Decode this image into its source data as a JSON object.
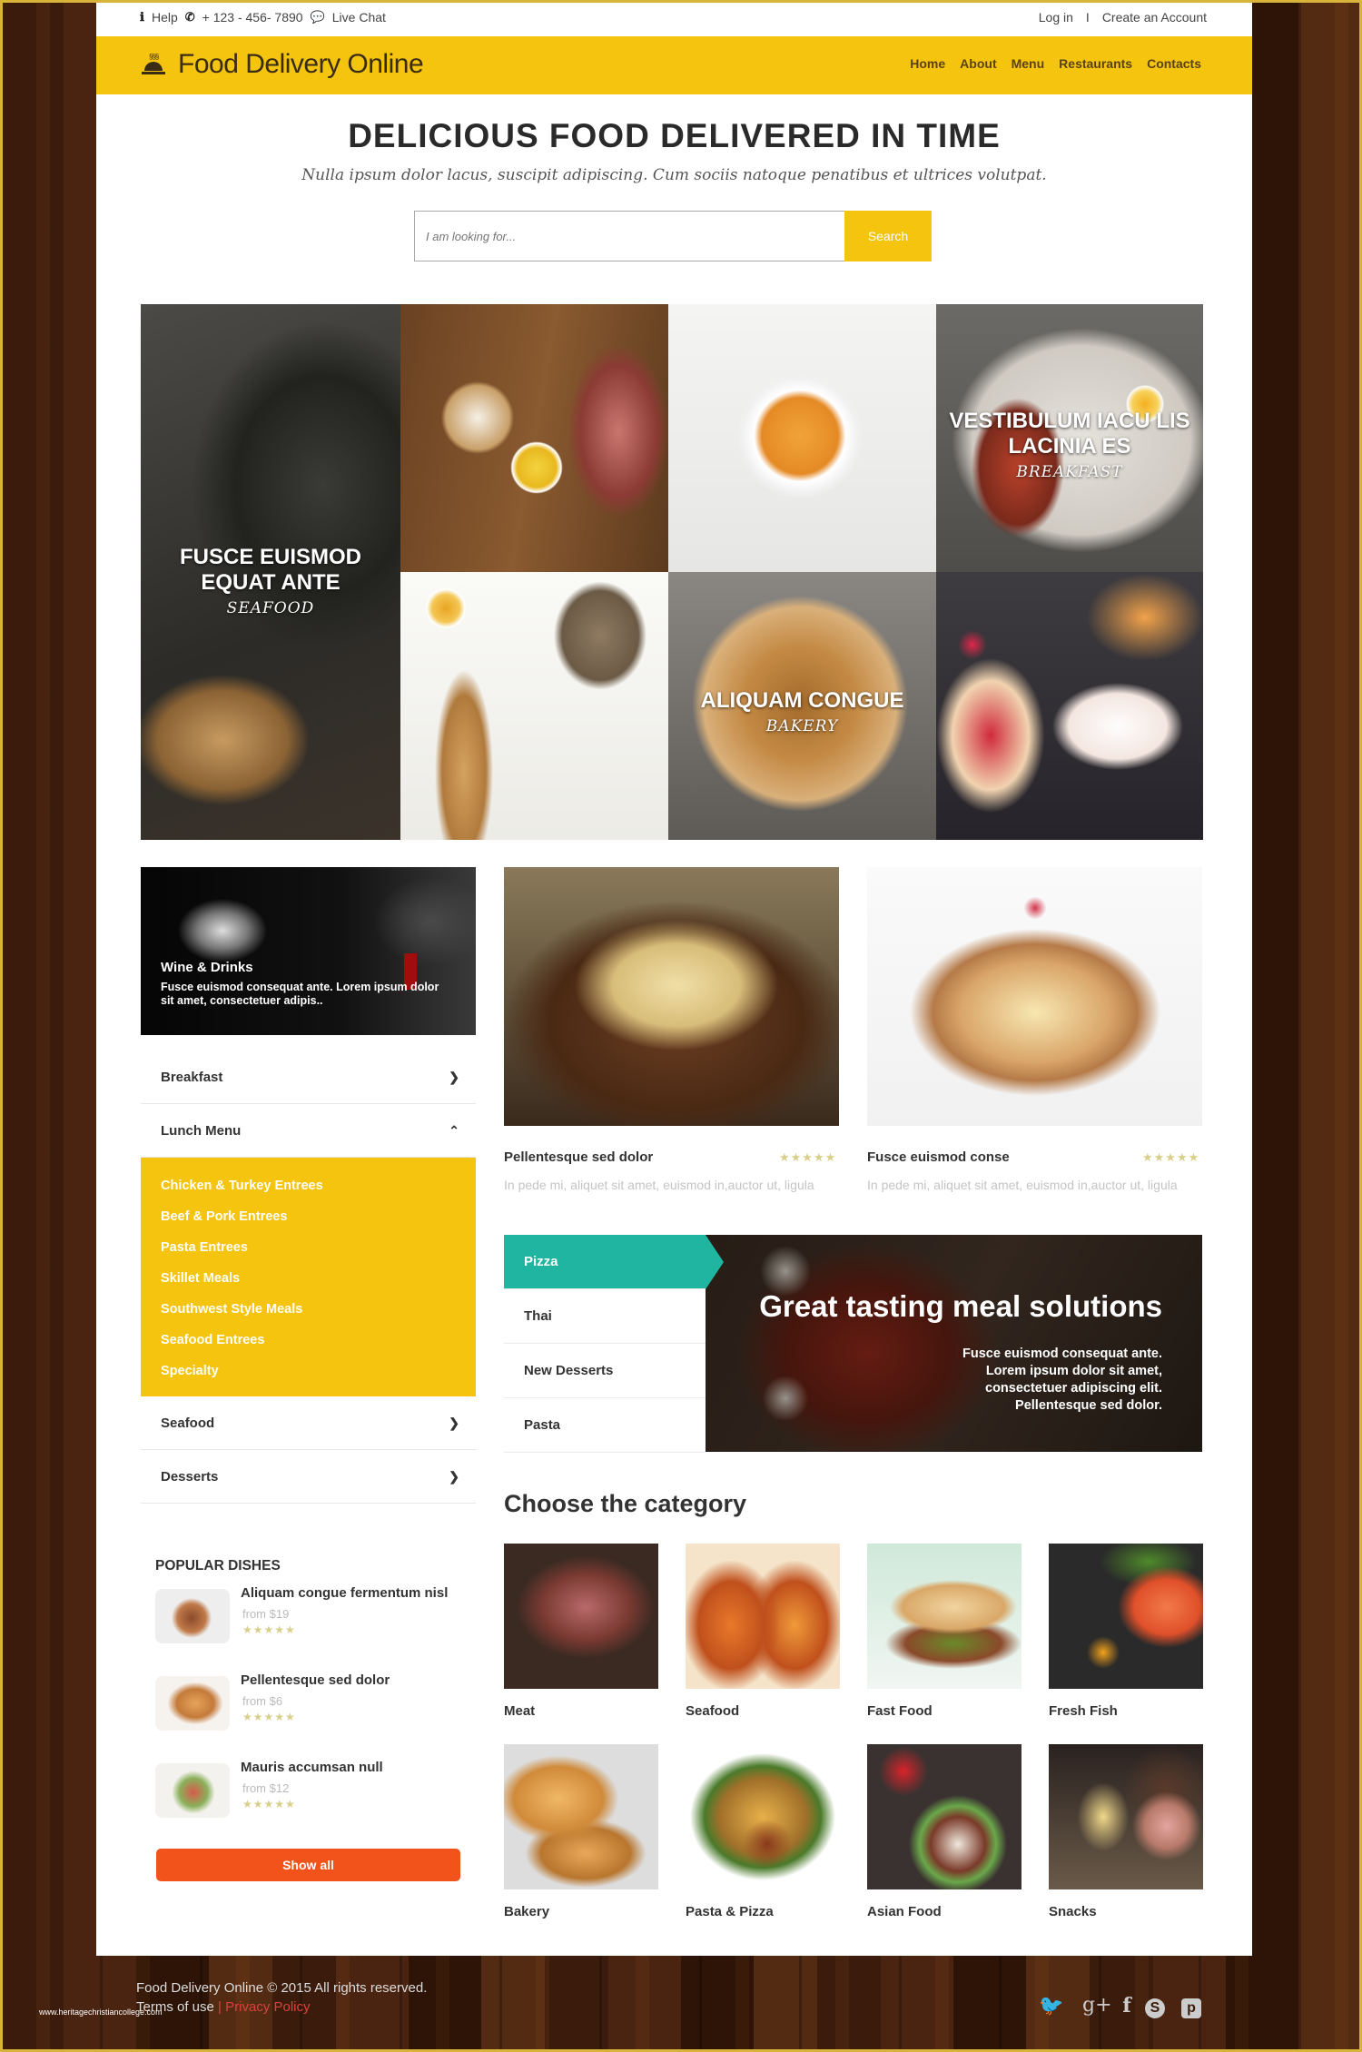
{
  "topbar": {
    "help": "Help",
    "phone": "+ 123 - 456- 7890",
    "chat": "Live Chat",
    "login": "Log in",
    "separator": "I",
    "create_account": "Create an Account"
  },
  "brand": {
    "name": "Food Delivery Online",
    "accent": "#f4c40f"
  },
  "nav": [
    "Home",
    "About",
    "Menu",
    "Restaurants",
    "Contacts"
  ],
  "hero": {
    "title": "DELICIOUS FOOD DELIVERED IN TIME",
    "subtitle": "Nulla ipsum dolor lacus, suscipit adipiscing. Cum sociis natoque penatibus et ultrices volutpat.",
    "search_placeholder": "I am looking for...",
    "search_button": "Search"
  },
  "mosaic": [
    {
      "title": "FUSCE EUISMOD EQUAT ANTE",
      "subtitle": "SEAFOOD"
    },
    {
      "title": "VESTIBULUM IACU LIS LACINIA ES",
      "subtitle": "BREAKFAST"
    },
    {
      "title": "ALIQUAM CONGUE",
      "subtitle": "BAKERY"
    }
  ],
  "sidebar": {
    "promo": {
      "title": "Wine & Drinks",
      "text": "Fusce euismod consequat ante. Lorem ipsum dolor sit amet, consectetuer adipis.."
    },
    "menu": [
      {
        "label": "Breakfast",
        "state": "collapsed"
      },
      {
        "label": "Lunch Menu",
        "state": "expanded"
      },
      {
        "label": "Seafood",
        "state": "collapsed"
      },
      {
        "label": "Desserts",
        "state": "collapsed"
      }
    ],
    "lunch_items": [
      "Chicken & Turkey Entrees",
      "Beef & Pork Entrees",
      "Pasta Entrees",
      "Skillet Meals",
      "Southwest Style Meals",
      "Seafood Entrees",
      "Specialty"
    ],
    "popular": {
      "title": "POPULAR DISHES",
      "items": [
        {
          "name": "Aliquam congue fermentum nisl",
          "price": "from $19",
          "rating": 5
        },
        {
          "name": "Pellentesque sed dolor",
          "price": "from $6",
          "rating": 5
        },
        {
          "name": "Mauris accumsan null",
          "price": "from $12",
          "rating": 5
        }
      ],
      "show_all": "Show all"
    }
  },
  "cards": [
    {
      "title": "Pellentesque sed dolor",
      "rating": 5,
      "text": "In pede mi, aliquet sit amet, euismod in,auctor ut, ligula"
    },
    {
      "title": "Fusce euismod conse",
      "rating": 5,
      "text": "In pede mi, aliquet sit amet, euismod in,auctor ut, ligula"
    }
  ],
  "tabs": [
    {
      "label": "Pizza",
      "active": true
    },
    {
      "label": "Thai",
      "active": false
    },
    {
      "label": "New Desserts",
      "active": false
    },
    {
      "label": "Pasta",
      "active": false
    }
  ],
  "banner": {
    "title": "Great tasting meal solutions",
    "text": "Fusce euismod consequat ante. Lorem ipsum dolor sit amet, consectetuer adipiscing elit. Pellentesque sed dolor."
  },
  "categories": {
    "title": "Choose the category",
    "items": [
      "Meat",
      "Seafood",
      "Fast Food",
      "Fresh Fish",
      "Bakery",
      "Pasta & Pizza",
      "Asian Food",
      "Snacks"
    ]
  },
  "footer": {
    "copyright": "Food Delivery Online © 2015 All rights reserved.",
    "terms": "Terms of use",
    "divider": "|",
    "privacy": "Privacy Policy",
    "watermark": "www.heritagechristiancollege.com",
    "social": [
      "twitter-icon",
      "google-plus-icon",
      "facebook-icon",
      "skype-icon",
      "pinterest-icon"
    ]
  },
  "stars": "★★★★★"
}
